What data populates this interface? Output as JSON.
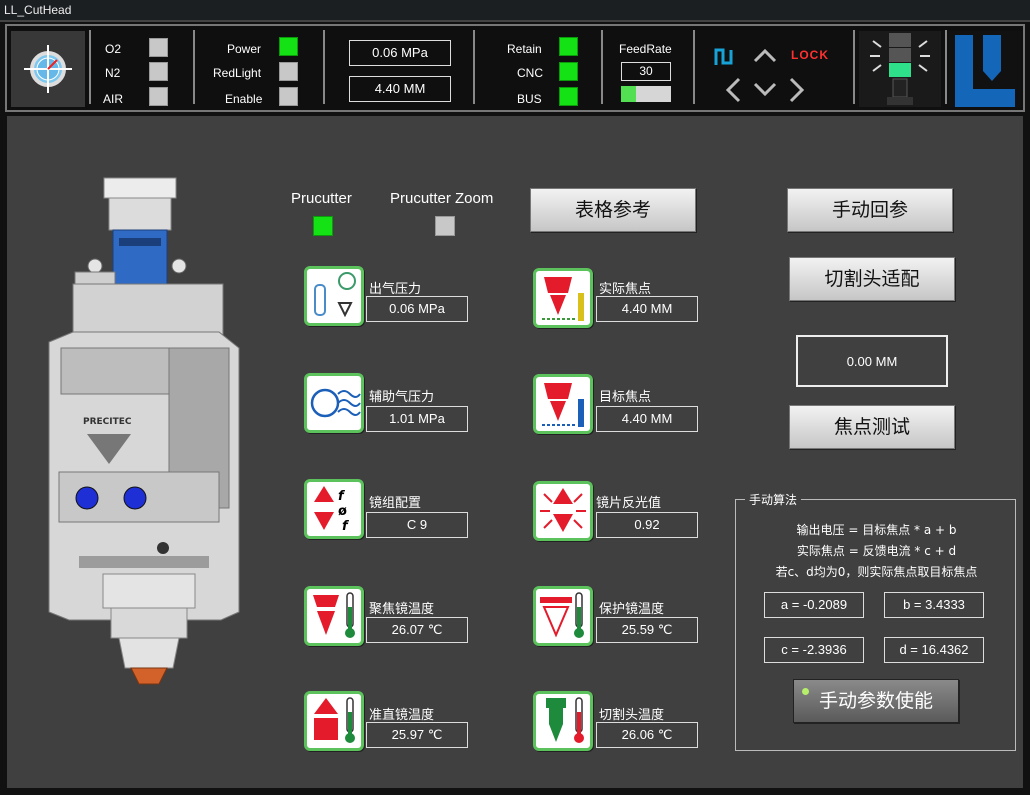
{
  "window": {
    "title": "LL_CutHead"
  },
  "status": {
    "gas": [
      {
        "label": "O2",
        "on": false
      },
      {
        "label": "N2",
        "on": false
      },
      {
        "label": "AIR",
        "on": false
      }
    ],
    "power": [
      {
        "label": "Power",
        "on": true
      },
      {
        "label": "RedLight",
        "on": false
      },
      {
        "label": "Enable",
        "on": false
      }
    ],
    "pressure_value": "0.06 MPa",
    "position_value": "4.40 MM",
    "system": [
      {
        "label": "Retain",
        "on": true
      },
      {
        "label": "CNC",
        "on": true
      },
      {
        "label": "BUS",
        "on": true
      }
    ],
    "feedrate": {
      "label": "FeedRate",
      "value": "30",
      "level": 0.3
    },
    "lock_label": "LOCK"
  },
  "main": {
    "prucutter": {
      "label": "Prucutter",
      "on": true
    },
    "prucutter_zoom": {
      "label": "Prucutter Zoom",
      "on": false
    },
    "table_ref_button": "表格参考",
    "home_button": "手动回参",
    "adapt_button": "切割头适配",
    "focus_display": "0.00 MM",
    "focus_test_button": "焦点测试",
    "brand": "PRECITEC",
    "metrics": [
      {
        "label": "出气压力",
        "value": "0.06 MPa",
        "icon": "gas-pressure-icon"
      },
      {
        "label": "实际焦点",
        "value": "4.40 MM",
        "icon": "actual-focus-icon"
      },
      {
        "label": "辅助气压力",
        "value": "1.01 MPa",
        "icon": "assist-gas-icon"
      },
      {
        "label": "目标焦点",
        "value": "4.40 MM",
        "icon": "target-focus-icon"
      },
      {
        "label": "镜组配置",
        "value": "C 9",
        "icon": "lens-config-icon"
      },
      {
        "label": "镜片反光值",
        "value": "0.92",
        "icon": "lens-reflect-icon"
      },
      {
        "label": "聚焦镜温度",
        "value": "26.07 ℃",
        "icon": "focus-lens-temp-icon"
      },
      {
        "label": "保护镜温度",
        "value": "25.59 ℃",
        "icon": "protect-lens-temp-icon"
      },
      {
        "label": "准直镜温度",
        "value": "25.97 ℃",
        "icon": "collimator-temp-icon"
      },
      {
        "label": "切割头温度",
        "value": "26.06 ℃",
        "icon": "cuthead-temp-icon"
      }
    ],
    "manual": {
      "title": "手动算法",
      "formulas": [
        "输出电压 = 目标焦点 * a + b",
        "实际焦点 = 反馈电流 * c + d",
        "若c、d均为0，则实际焦点取目标焦点"
      ],
      "params": [
        "a = -0.2089",
        "b = 3.4333",
        "c = -2.3936",
        "d = 16.4362"
      ],
      "enable_button": "手动参数使能"
    }
  },
  "colors": {
    "green": "#14e214",
    "red": "#e31b2b",
    "logo_blue": "#1466b8"
  }
}
